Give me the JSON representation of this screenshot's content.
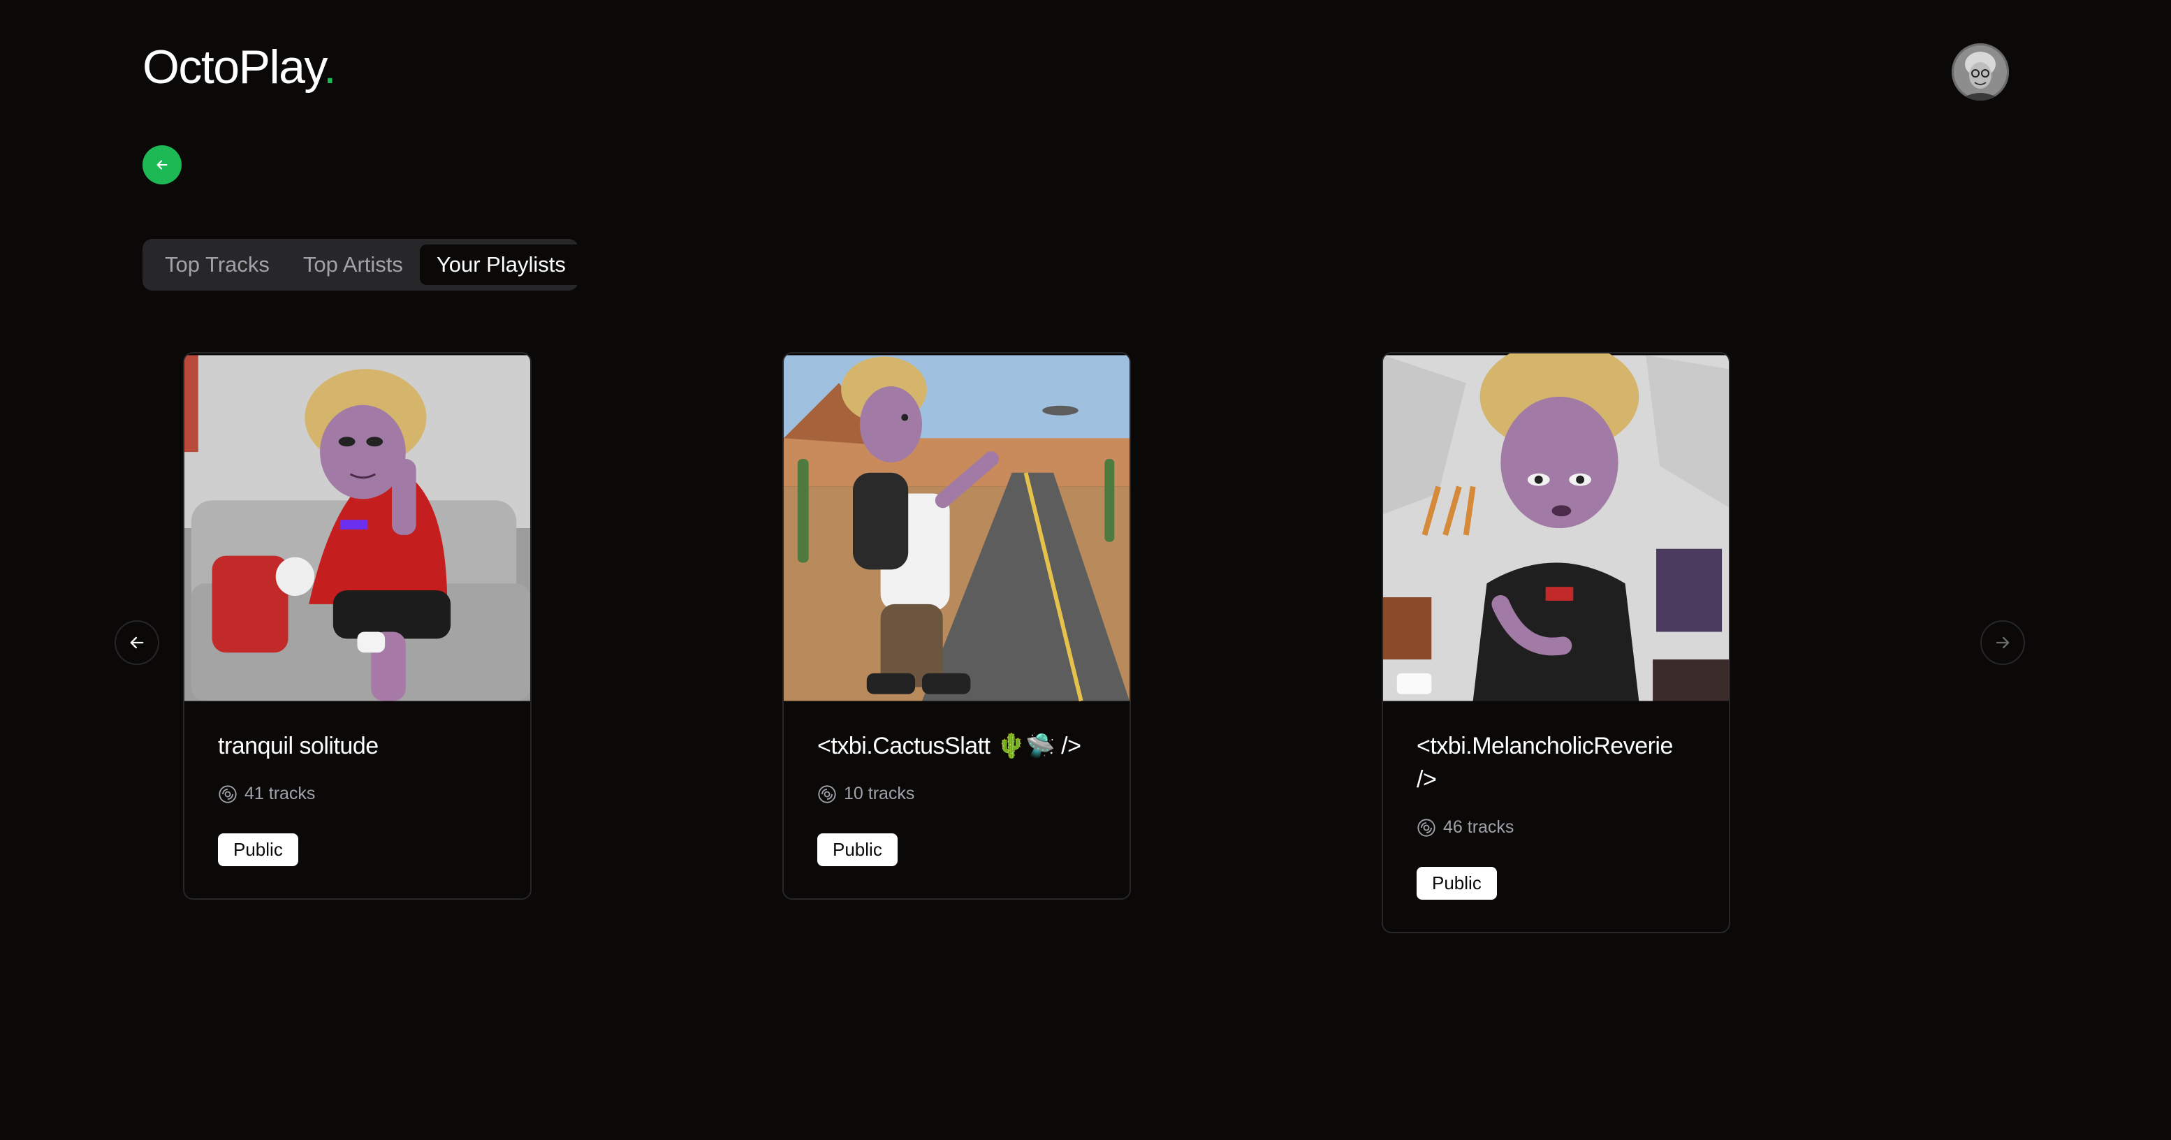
{
  "app": {
    "logo_text": "OctoPlay",
    "logo_dot": ".",
    "accent": "#1db954"
  },
  "header": {
    "avatar_icon": "user-avatar"
  },
  "nav": {
    "back_icon": "arrow-left-icon"
  },
  "tabs": [
    {
      "label": "Top Tracks",
      "active": false
    },
    {
      "label": "Top Artists",
      "active": false
    },
    {
      "label": "Your Playlists",
      "active": true
    }
  ],
  "carousel": {
    "prev_icon": "arrow-left-icon",
    "next_icon": "arrow-right-icon",
    "playlists": [
      {
        "title": "tranquil solitude",
        "tracks": "41 tracks",
        "visibility": "Public"
      },
      {
        "title": "<txbi.CactusSlatt 🌵🛸 />",
        "tracks": "10 tracks",
        "visibility": "Public"
      },
      {
        "title": "<txbi.MelancholicReverie />",
        "tracks": "46 tracks",
        "visibility": "Public"
      }
    ]
  }
}
